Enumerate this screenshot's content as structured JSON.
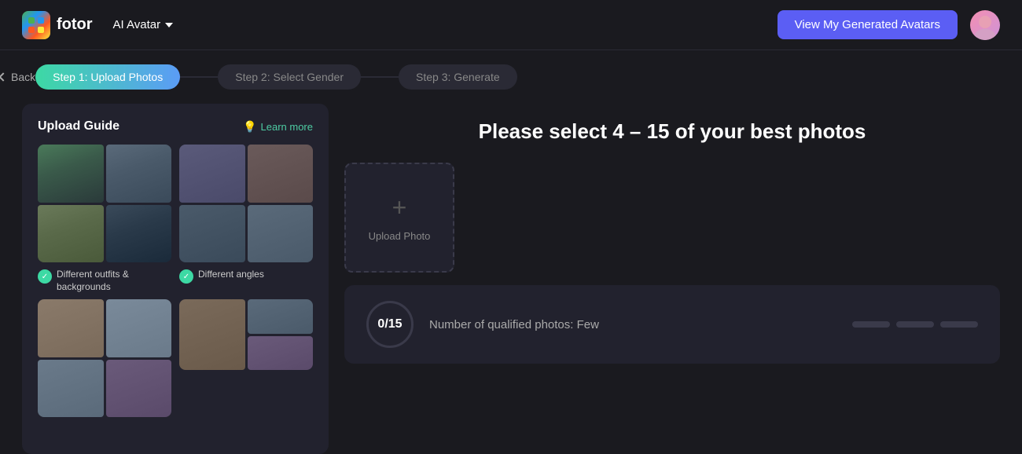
{
  "header": {
    "logo_text": "fotor",
    "ai_avatar_label": "AI Avatar",
    "view_avatars_btn": "View My Generated Avatars"
  },
  "steps": {
    "step1_label": "Step 1: Upload Photos",
    "step2_label": "Step 2: Select Gender",
    "step3_label": "Step 3: Generate"
  },
  "back_label": "Back",
  "guide": {
    "title": "Upload Guide",
    "learn_more": "Learn more",
    "item1_label": "Different outfits &\nbackgrounds",
    "item2_label": "Different angles"
  },
  "main": {
    "select_title": "Please select 4 – 15 of your best photos",
    "upload_label": "Upload Photo",
    "progress_count": "0/15",
    "qualified_text": "Number of qualified photos: Few"
  }
}
